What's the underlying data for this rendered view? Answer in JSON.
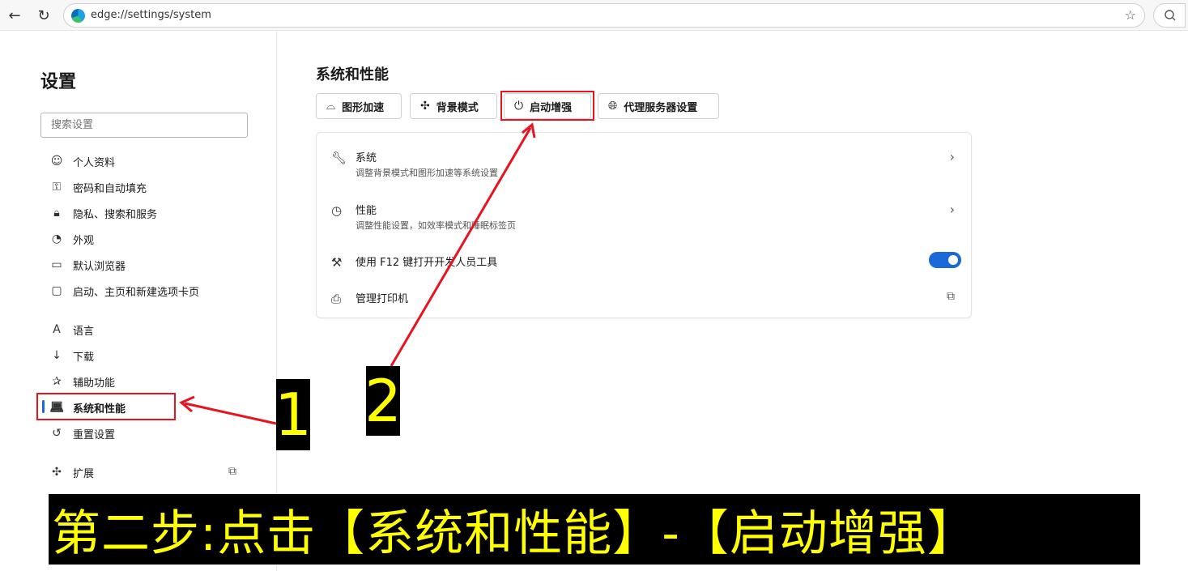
{
  "browser": {
    "url": "edge://settings/system",
    "back_icon": "←",
    "refresh_icon": "↻"
  },
  "sidebar": {
    "title": "设置",
    "search_placeholder": "搜索设置",
    "items": [
      {
        "label": "个人资料",
        "icon": "profile-icon"
      },
      {
        "label": "密码和自动填充",
        "icon": "key-icon"
      },
      {
        "label": "隐私、搜索和服务",
        "icon": "lock-icon"
      },
      {
        "label": "外观",
        "icon": "palette-icon"
      },
      {
        "label": "默认浏览器",
        "icon": "browser-icon"
      },
      {
        "label": "启动、主页和新建选项卡页",
        "icon": "home-icon"
      },
      {
        "label": "语言",
        "icon": "language-icon"
      },
      {
        "label": "下载",
        "icon": "download-icon"
      },
      {
        "label": "辅助功能",
        "icon": "accessibility-icon"
      },
      {
        "label": "系统和性能",
        "icon": "laptop-icon",
        "active": true
      },
      {
        "label": "重置设置",
        "icon": "reset-icon"
      },
      {
        "label": "扩展",
        "icon": "puzzle-icon"
      }
    ]
  },
  "main": {
    "title": "系统和性能",
    "chips": [
      {
        "label": "图形加速",
        "icon": "gpu-icon"
      },
      {
        "label": "背景模式",
        "icon": "puzzle-icon"
      },
      {
        "label": "启动增强",
        "icon": "power-icon"
      },
      {
        "label": "代理服务器设置",
        "icon": "globe-icon"
      }
    ],
    "rows": [
      {
        "title": "系统",
        "subtitle": "调整背景模式和图形加速等系统设置",
        "icon": "wrench-icon"
      },
      {
        "title": "性能",
        "subtitle": "调整性能设置，如效率模式和睡眠标签页",
        "icon": "gauge-icon"
      },
      {
        "title": "使用 F12 键打开开发人员工具",
        "icon": "tools-icon",
        "toggle_on": true
      },
      {
        "title": "管理打印机",
        "icon": "printer-icon"
      }
    ]
  },
  "annotations": {
    "step1": "1",
    "step2": "2",
    "banner": "第二步:点击【系统和性能】-【启动增强】",
    "color_red": "#e8131f",
    "color_yellow": "#ffff00"
  }
}
